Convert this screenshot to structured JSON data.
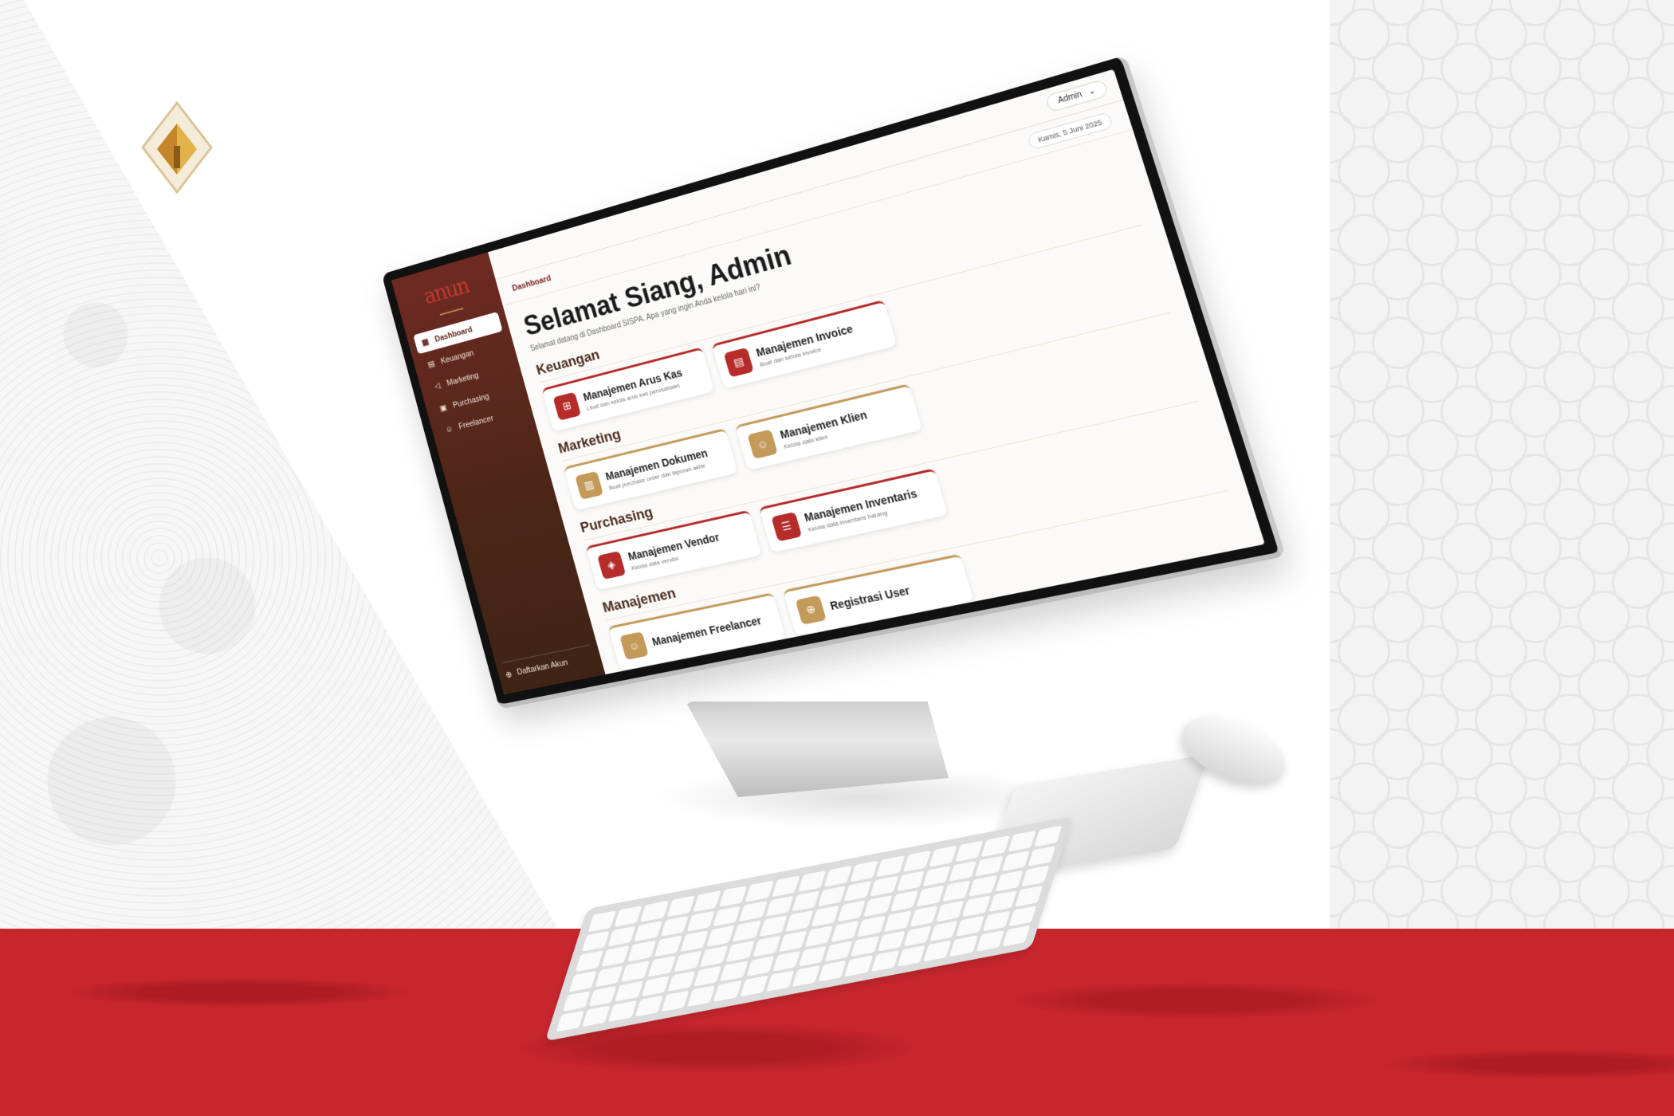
{
  "sidebar": {
    "logo_text": "anun",
    "items": [
      {
        "label": "Dashboard",
        "icon": "grid-icon"
      },
      {
        "label": "Keuangan",
        "icon": "document-icon"
      },
      {
        "label": "Marketing",
        "icon": "megaphone-icon"
      },
      {
        "label": "Purchasing",
        "icon": "box-icon"
      },
      {
        "label": "Freelancer",
        "icon": "users-icon"
      }
    ],
    "footer_label": "Daftarkan Akun"
  },
  "topbar": {
    "user_label": "Admin"
  },
  "breadcrumb": "Dashboard",
  "date": "Kamis, 5 Juni 2025",
  "greeting": "Selamat Siang, Admin",
  "subtitle": "Selamat datang di Dashboard SISPA. Apa yang ingin Anda kelola hari ini?",
  "sections": [
    {
      "title": "Keuangan",
      "cards": [
        {
          "title": "Manajemen Arus Kas",
          "desc": "Lihat dan kelola arus kas perusahaan"
        },
        {
          "title": "Manajemen Invoice",
          "desc": "Buat dan kelola invoice"
        }
      ]
    },
    {
      "title": "Marketing",
      "cards": [
        {
          "title": "Manajemen Dokumen",
          "desc": "Buat purchase order dan laporan akhir"
        },
        {
          "title": "Manajemen Klien",
          "desc": "Kelola data klien"
        }
      ]
    },
    {
      "title": "Purchasing",
      "cards": [
        {
          "title": "Manajemen Vendor",
          "desc": "Kelola data vendor"
        },
        {
          "title": "Manajemen Inventaris",
          "desc": "Kelola data inventaris barang"
        }
      ]
    },
    {
      "title": "Manajemen",
      "cards": [
        {
          "title": "Manajemen Freelancer",
          "desc": ""
        },
        {
          "title": "Registrasi User",
          "desc": ""
        }
      ]
    }
  ],
  "colors": {
    "brand_red": "#c8262d",
    "sidebar_brown": "#4a2617",
    "gold": "#c49a5b"
  }
}
